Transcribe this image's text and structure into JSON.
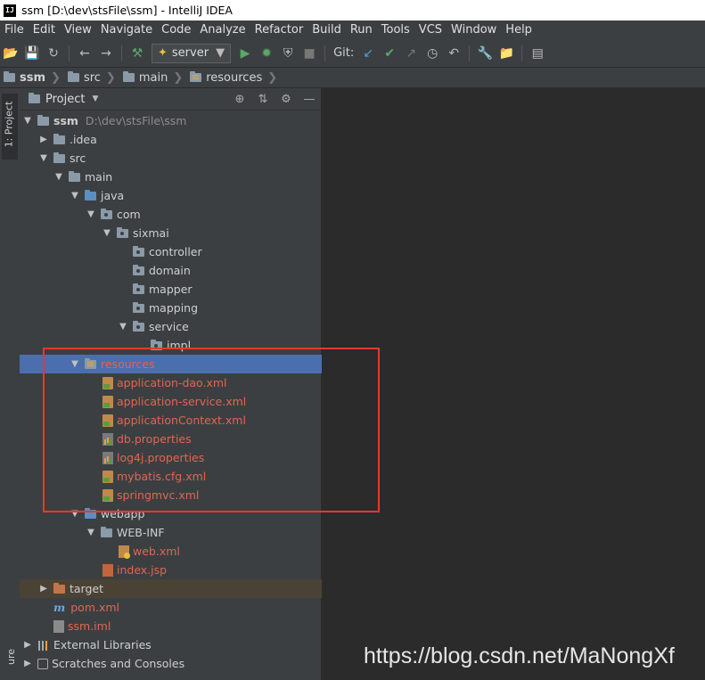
{
  "window": {
    "icon_text": "IJ",
    "title": "ssm [D:\\dev\\stsFile\\ssm] - IntelliJ IDEA"
  },
  "menu": [
    "File",
    "Edit",
    "View",
    "Navigate",
    "Code",
    "Analyze",
    "Refactor",
    "Build",
    "Run",
    "Tools",
    "VCS",
    "Window",
    "Help"
  ],
  "toolbar": {
    "run_config": "server",
    "git_label": "Git:"
  },
  "breadcrumbs": [
    "ssm",
    "src",
    "main",
    "resources"
  ],
  "side_tabs": {
    "project": "1: Project",
    "structure": "ure"
  },
  "panel": {
    "title": "Project"
  },
  "tree": {
    "root": {
      "name": "ssm",
      "path": "D:\\dev\\stsFile\\ssm"
    },
    "idea": ".idea",
    "src": "src",
    "main": "main",
    "java": "java",
    "com": "com",
    "sixmai": "sixmai",
    "controller": "controller",
    "domain": "domain",
    "mapper": "mapper",
    "mapping": "mapping",
    "service": "service",
    "impl": "impl",
    "resources": "resources",
    "resource_files": [
      "application-dao.xml",
      "application-service.xml",
      "applicationContext.xml",
      "db.properties",
      "log4j.properties",
      "mybatis.cfg.xml",
      "springmvc.xml"
    ],
    "webapp": "webapp",
    "webinf": "WEB-INF",
    "webxml": "web.xml",
    "indexjsp": "index.jsp",
    "target": "target",
    "pom": "pom.xml",
    "iml": "ssm.iml",
    "extlibs": "External Libraries",
    "scratches": "Scratches and Consoles"
  },
  "watermark": "https://blog.csdn.net/MaNongXf"
}
